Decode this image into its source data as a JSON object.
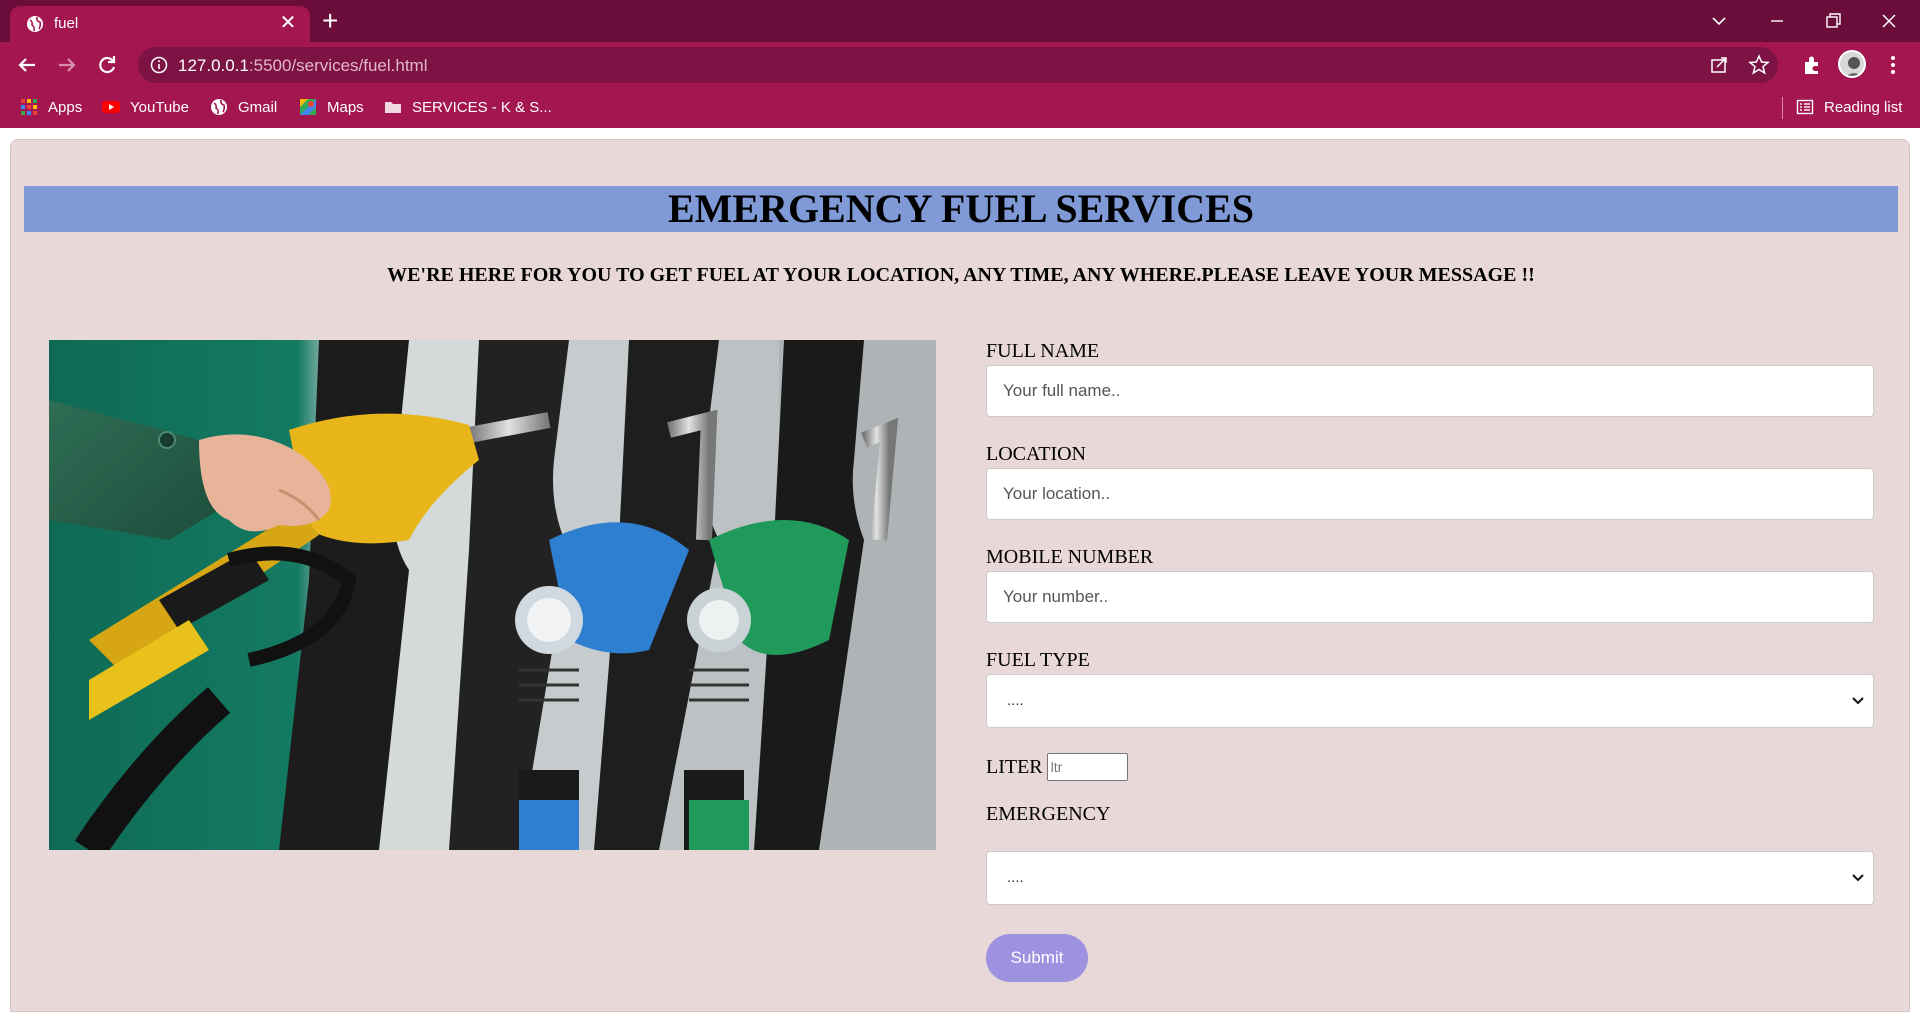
{
  "browser": {
    "tab_title": "fuel",
    "tab_close": "✕",
    "new_tab": "+",
    "url_host": "127.0.0.1",
    "url_rest": ":5500/services/fuel.html",
    "bookmarks": [
      {
        "label": "Apps",
        "icon": "apps-grid-icon"
      },
      {
        "label": "YouTube",
        "icon": "youtube-icon"
      },
      {
        "label": "Gmail",
        "icon": "globe-icon"
      },
      {
        "label": "Maps",
        "icon": "maps-icon"
      },
      {
        "label": "SERVICES - K & S...",
        "icon": "folder-icon"
      }
    ],
    "reading_list": "Reading list",
    "colors": {
      "frame": "#6a0d3a",
      "toolbar": "#a3164f"
    }
  },
  "page": {
    "heading": "EMERGENCY FUEL SERVICES",
    "tagline": "WE'RE HERE FOR YOU TO GET FUEL AT YOUR LOCATION, ANY TIME, ANY WHERE.PLEASE LEAVE YOUR MESSAGE !!",
    "image_alt": "fuel pump nozzles",
    "form": {
      "full_name_label": "FULL NAME",
      "full_name_placeholder": "Your full  name..",
      "location_label": "LOCATION",
      "location_placeholder": "Your location..",
      "mobile_label": "MOBILE NUMBER",
      "mobile_placeholder": "Your number..",
      "fuel_type_label": "FUEL TYPE",
      "fuel_type_value": "....",
      "liter_label": "LITER",
      "liter_placeholder": "ltr",
      "emergency_label": "EMERGENCY",
      "emergency_value": "....",
      "submit_label": "Submit"
    },
    "colors": {
      "background": "#e8d8d8",
      "banner": "#7f9ad6",
      "submit": "#9d92df"
    }
  }
}
